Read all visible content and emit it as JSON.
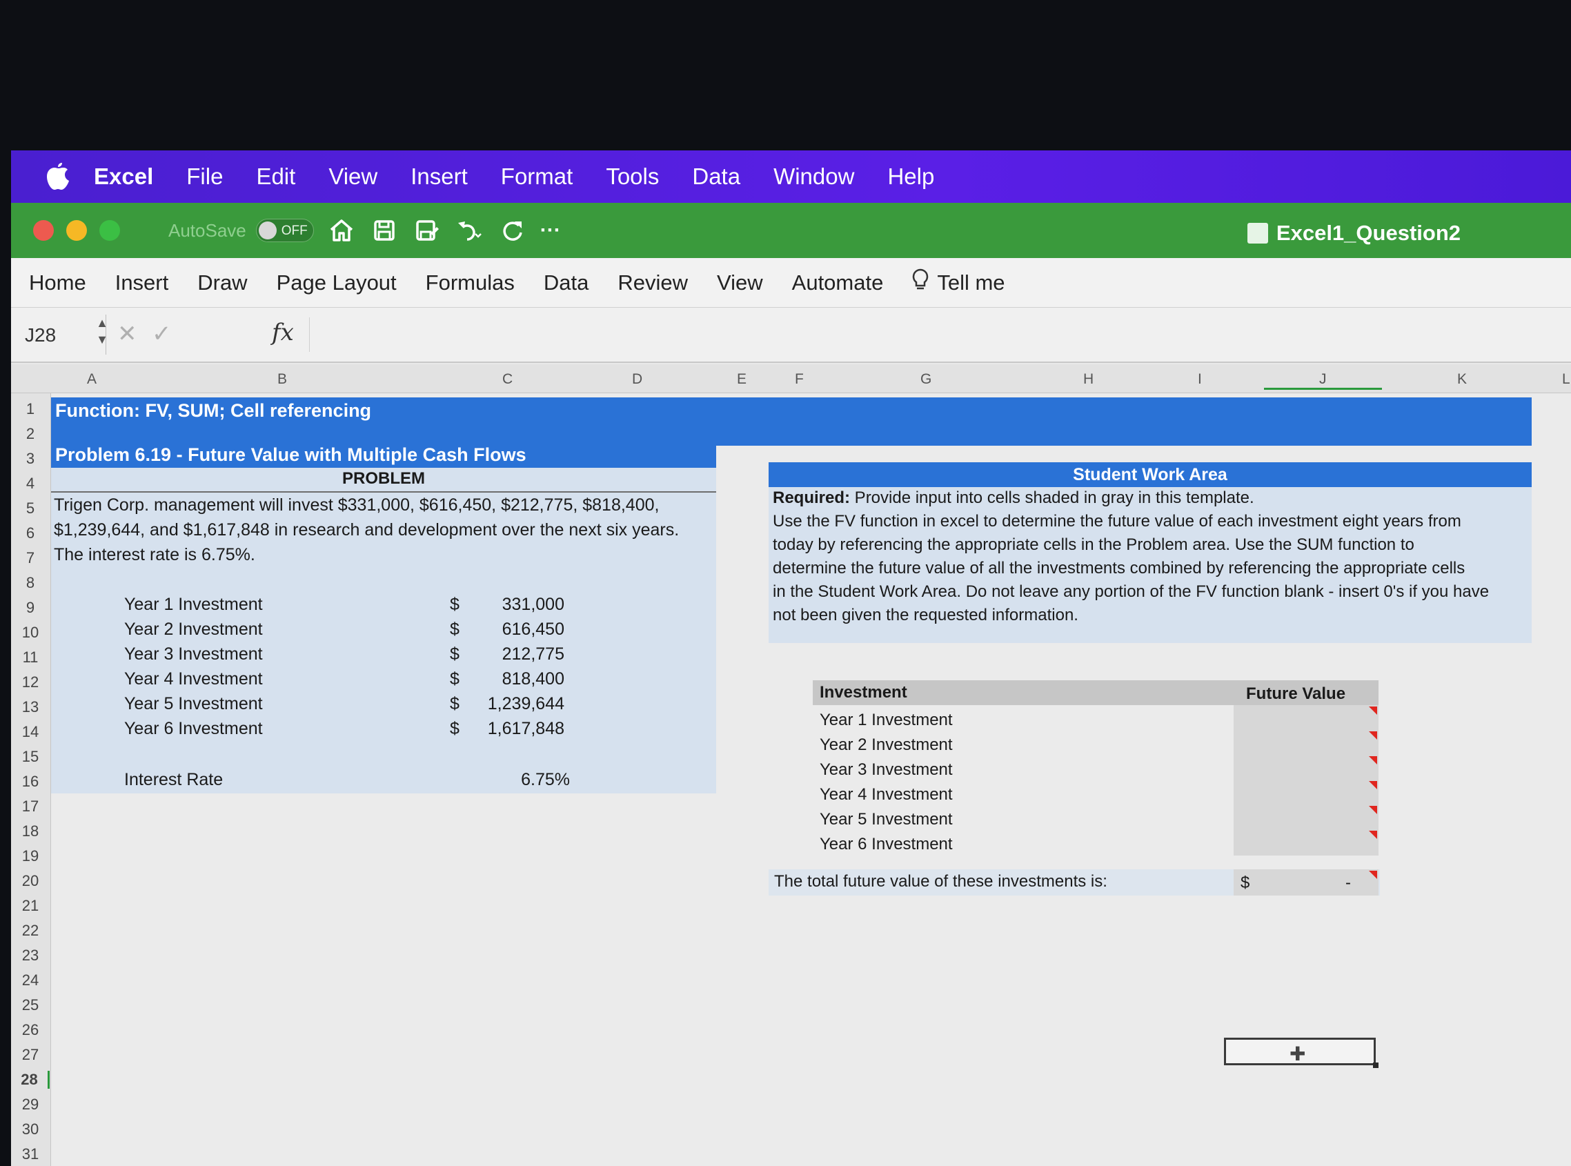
{
  "menubar": {
    "app": "Excel",
    "items": [
      "File",
      "Edit",
      "View",
      "Insert",
      "Format",
      "Tools",
      "Data",
      "Window",
      "Help"
    ]
  },
  "titlebar": {
    "autosave_label": "AutoSave",
    "autosave_state": "OFF",
    "more": "···",
    "doc_title": "Excel1_Question2"
  },
  "ribbon": {
    "tabs": [
      "Home",
      "Insert",
      "Draw",
      "Page Layout",
      "Formulas",
      "Data",
      "Review",
      "View",
      "Automate"
    ],
    "tell_me": "Tell me"
  },
  "formula_bar": {
    "name_box": "J28",
    "cancel": "✕",
    "enter": "✓",
    "fx": "fx"
  },
  "columns": [
    "A",
    "B",
    "C",
    "D",
    "E",
    "F",
    "G",
    "H",
    "I",
    "J",
    "K",
    "L"
  ],
  "rows": [
    "1",
    "2",
    "3",
    "4",
    "5",
    "6",
    "7",
    "8",
    "9",
    "10",
    "11",
    "12",
    "13",
    "14",
    "15",
    "16",
    "17",
    "18",
    "19",
    "20",
    "21",
    "22",
    "23",
    "24",
    "25",
    "26",
    "27",
    "28",
    "29",
    "30",
    "31"
  ],
  "sheet": {
    "header": "Function: FV, SUM; Cell referencing",
    "problem_title": "Problem 6.19 - Future Value with Multiple Cash Flows",
    "problem_label": "PROBLEM",
    "problem_text": [
      "Trigen Corp. management will invest $331,000, $616,450, $212,775, $818,400,",
      "$1,239,644, and $1,617,848 in research and development over the next six years.",
      "The interest rate is 6.75%."
    ],
    "investments": [
      {
        "label": "Year 1 Investment",
        "currency": "$",
        "amount": "331,000"
      },
      {
        "label": "Year 2 Investment",
        "currency": "$",
        "amount": "616,450"
      },
      {
        "label": "Year 3 Investment",
        "currency": "$",
        "amount": "212,775"
      },
      {
        "label": "Year 4 Investment",
        "currency": "$",
        "amount": "818,400"
      },
      {
        "label": "Year 5 Investment",
        "currency": "$",
        "amount": "1,239,644"
      },
      {
        "label": "Year 6 Investment",
        "currency": "$",
        "amount": "1,617,848"
      }
    ],
    "interest_label": "Interest Rate",
    "interest_value": "6.75%",
    "work_area_title": "Student Work Area",
    "required_label": "Required:",
    "required_lines": [
      " Provide input into cells shaded in gray in this template.",
      "Use the FV function in excel to determine the future value of each investment eight years from",
      "today by referencing the appropriate cells in the Problem area. Use the SUM function to",
      "determine the future value of all the investments combined by referencing the appropriate cells",
      "in the Student Work Area. Do not leave any portion of the FV function blank - insert 0's if you have",
      "not been given the requested information."
    ],
    "table_header_investment": "Investment",
    "table_header_fv": "Future Value",
    "table_rows": [
      "Year 1 Investment",
      "Year 2 Investment",
      "Year 3 Investment",
      "Year 4 Investment",
      "Year 5 Investment",
      "Year 6 Investment"
    ],
    "total_label": "The total future value of these investments is:",
    "total_currency": "$",
    "total_value": "-"
  },
  "colors": {
    "menubar": "#5a1fe6",
    "titlebar": "#3a9a3c",
    "banner": "#2a72d6",
    "panel": "#d6e1ee",
    "input_gray": "#d7d7d7",
    "comment_marker": "#e0261f"
  }
}
